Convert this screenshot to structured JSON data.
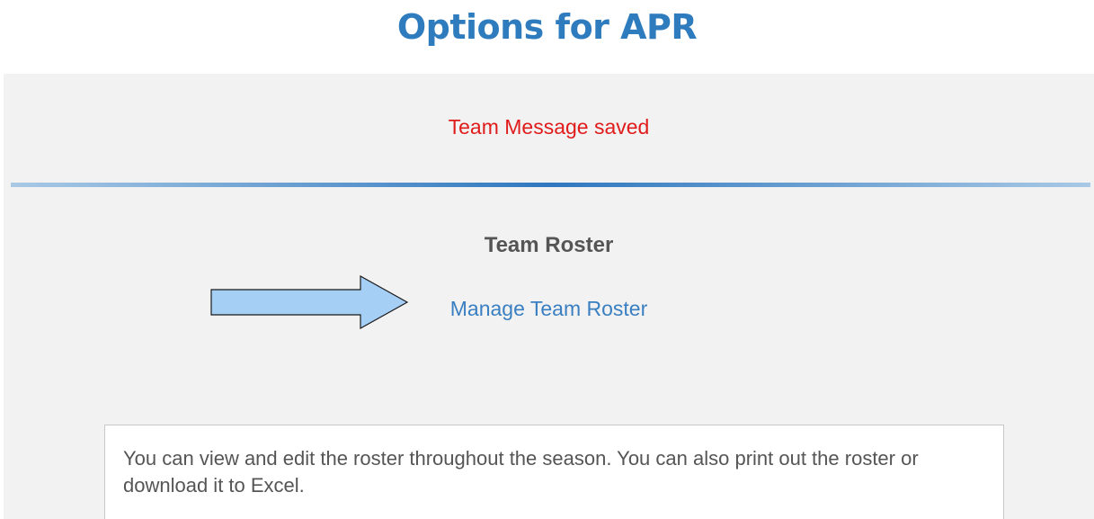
{
  "page": {
    "title": "Options for APR"
  },
  "status": {
    "message": "Team Message saved",
    "color": "#e01b1b"
  },
  "roster": {
    "heading": "Team Roster",
    "link_label": "Manage Team Roster",
    "description": "You can view and edit the roster throughout the season. You can also print out the roster or download it to Excel."
  },
  "annotation": {
    "icon": "right-arrow-icon",
    "color": "#a6cff5"
  },
  "colors": {
    "title": "#2e7bbd",
    "link": "#3a7fc1",
    "panel_bg": "#f2f2f2",
    "divider": "#2f78bf"
  }
}
